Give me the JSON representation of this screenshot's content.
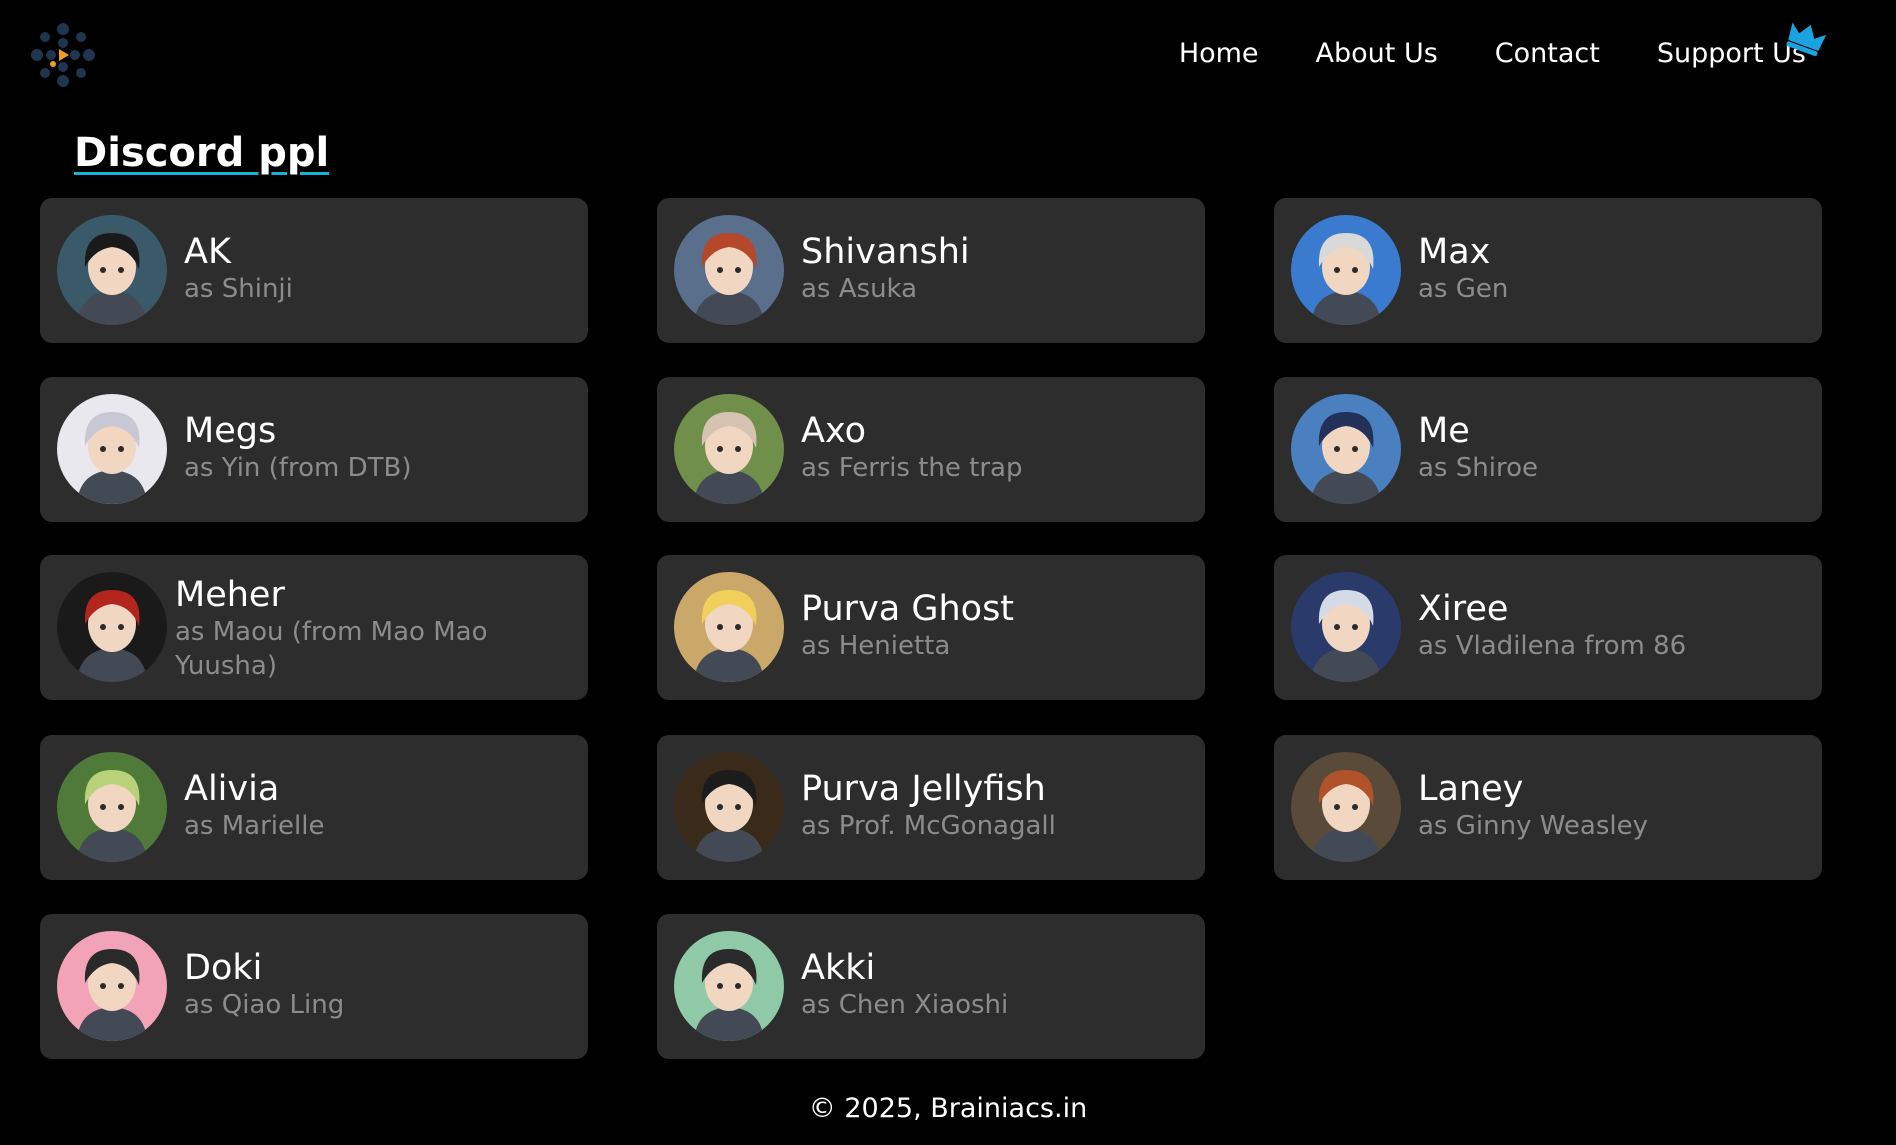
{
  "nav": {
    "items": [
      "Home",
      "About Us",
      "Contact",
      "Support Us"
    ]
  },
  "section_title": "Discord ppl",
  "members": [
    {
      "name": "AK",
      "role": "as Shinji",
      "color": "#3a5a6a",
      "hair": "#1a1a1a"
    },
    {
      "name": "Shivanshi",
      "role": "as Asuka",
      "color": "#5a6f8c",
      "hair": "#b5472a"
    },
    {
      "name": "Max",
      "role": "as Gen",
      "color": "#3a7bd0",
      "hair": "#d9d9d9"
    },
    {
      "name": "Megs",
      "role": "as Yin (from DTB)",
      "color": "#e8e8ee",
      "hair": "#c8c8d4"
    },
    {
      "name": "Axo",
      "role": "as Ferris the trap",
      "color": "#6f8f4a",
      "hair": "#d6c2b0"
    },
    {
      "name": "Me",
      "role": "as Shiroe",
      "color": "#4a7fc0",
      "hair": "#22305a"
    },
    {
      "name": "Meher",
      "role": "as Maou (from Mao Mao Yuusha)",
      "color": "#1a1a1a",
      "hair": "#b3261e"
    },
    {
      "name": "Purva Ghost",
      "role": "as Henietta",
      "color": "#c9a86a",
      "hair": "#f0d05a"
    },
    {
      "name": "Xiree",
      "role": "as Vladilena from 86",
      "color": "#2a3a6a",
      "hair": "#d4dbe6"
    },
    {
      "name": "Alivia",
      "role": "as Marielle",
      "color": "#4f7a3a",
      "hair": "#b9d27a"
    },
    {
      "name": "Purva Jellyfish",
      "role": "as Prof. McGonagall",
      "color": "#3a2a1a",
      "hair": "#1c1c1c"
    },
    {
      "name": "Laney",
      "role": "as Ginny Weasley",
      "color": "#5a4a3a",
      "hair": "#b0522a"
    },
    {
      "name": "Doki",
      "role": "as Qiao Ling",
      "color": "#f2a3b8",
      "hair": "#2a2a2a"
    },
    {
      "name": "Akki",
      "role": "as Chen Xiaoshi",
      "color": "#8fc9a8",
      "hair": "#2a2a2a"
    }
  ],
  "footer": "© 2025, Brainiacs.in",
  "colors": {
    "background": "#000000",
    "card": "#2d2d2d",
    "accent": "#14b4d6",
    "logo_dots": "#1f3550",
    "logo_accent": "#f0a020"
  }
}
